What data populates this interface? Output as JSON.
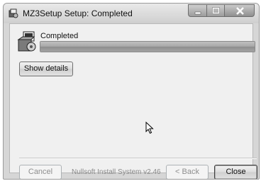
{
  "window": {
    "title": "MZ3Setup Setup: Completed",
    "title_icon": "installer-icon",
    "caption_icons": [
      "minimize-icon",
      "maximize-icon",
      "close-icon"
    ]
  },
  "header": {
    "icon": "installer-box-icon",
    "status": "Completed",
    "progress_percent": 100
  },
  "buttons": {
    "show_details": "Show details",
    "cancel": "Cancel",
    "back": "< Back",
    "close": "Close"
  },
  "footer": {
    "branding": "Nullsoft Install System v2.46"
  },
  "colors": {
    "window_frame": "#d6d6d6",
    "client_bg": "#f0f0f0",
    "progress_fill": "#a6a6a6",
    "disabled_text": "#8e8e8e"
  }
}
